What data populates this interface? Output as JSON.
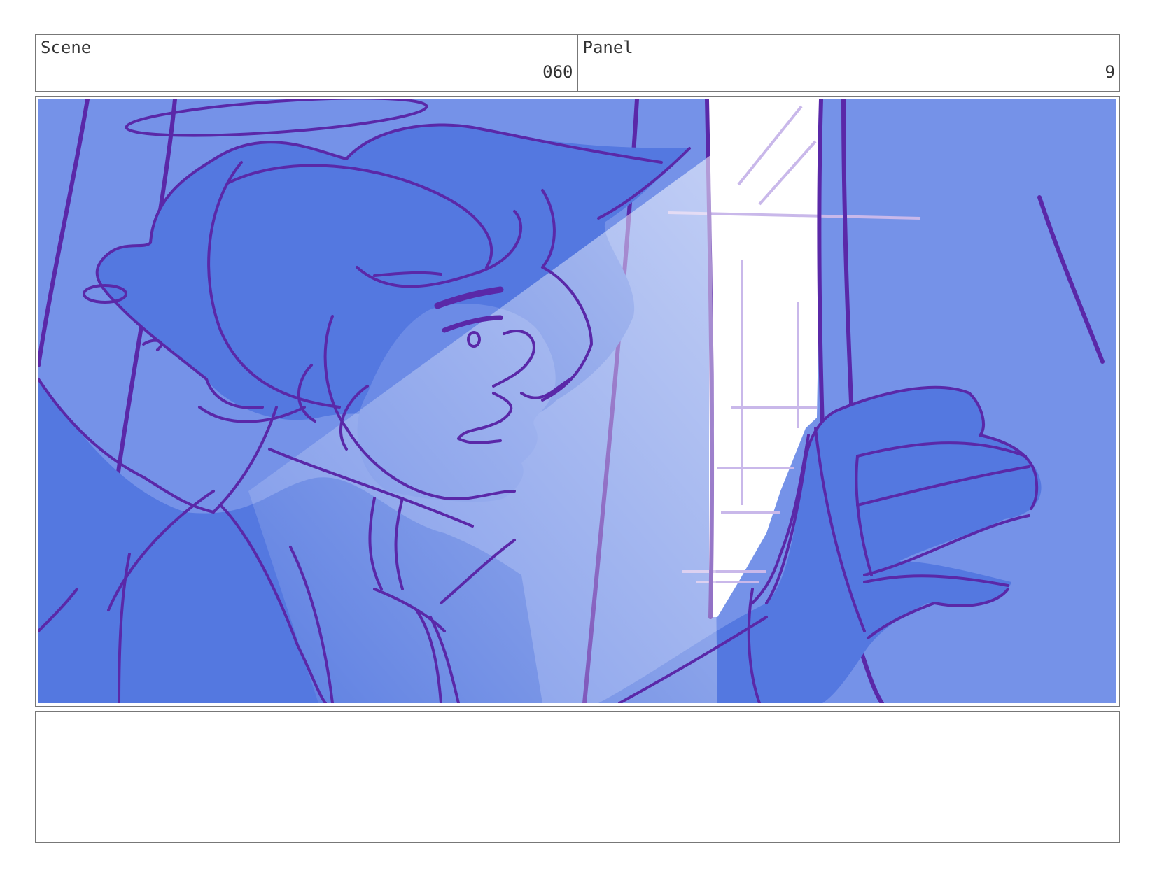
{
  "header": {
    "scene_label": "Scene",
    "scene_value": "060",
    "panel_label": "Panel",
    "panel_value": "9"
  },
  "frame": {
    "description_icon": "storyboard-drawing"
  },
  "notes": {
    "text": ""
  },
  "colors": {
    "background": "#7592e8",
    "figure": "#5478e0",
    "line": "#5a28a8",
    "light": "#ffffff"
  }
}
